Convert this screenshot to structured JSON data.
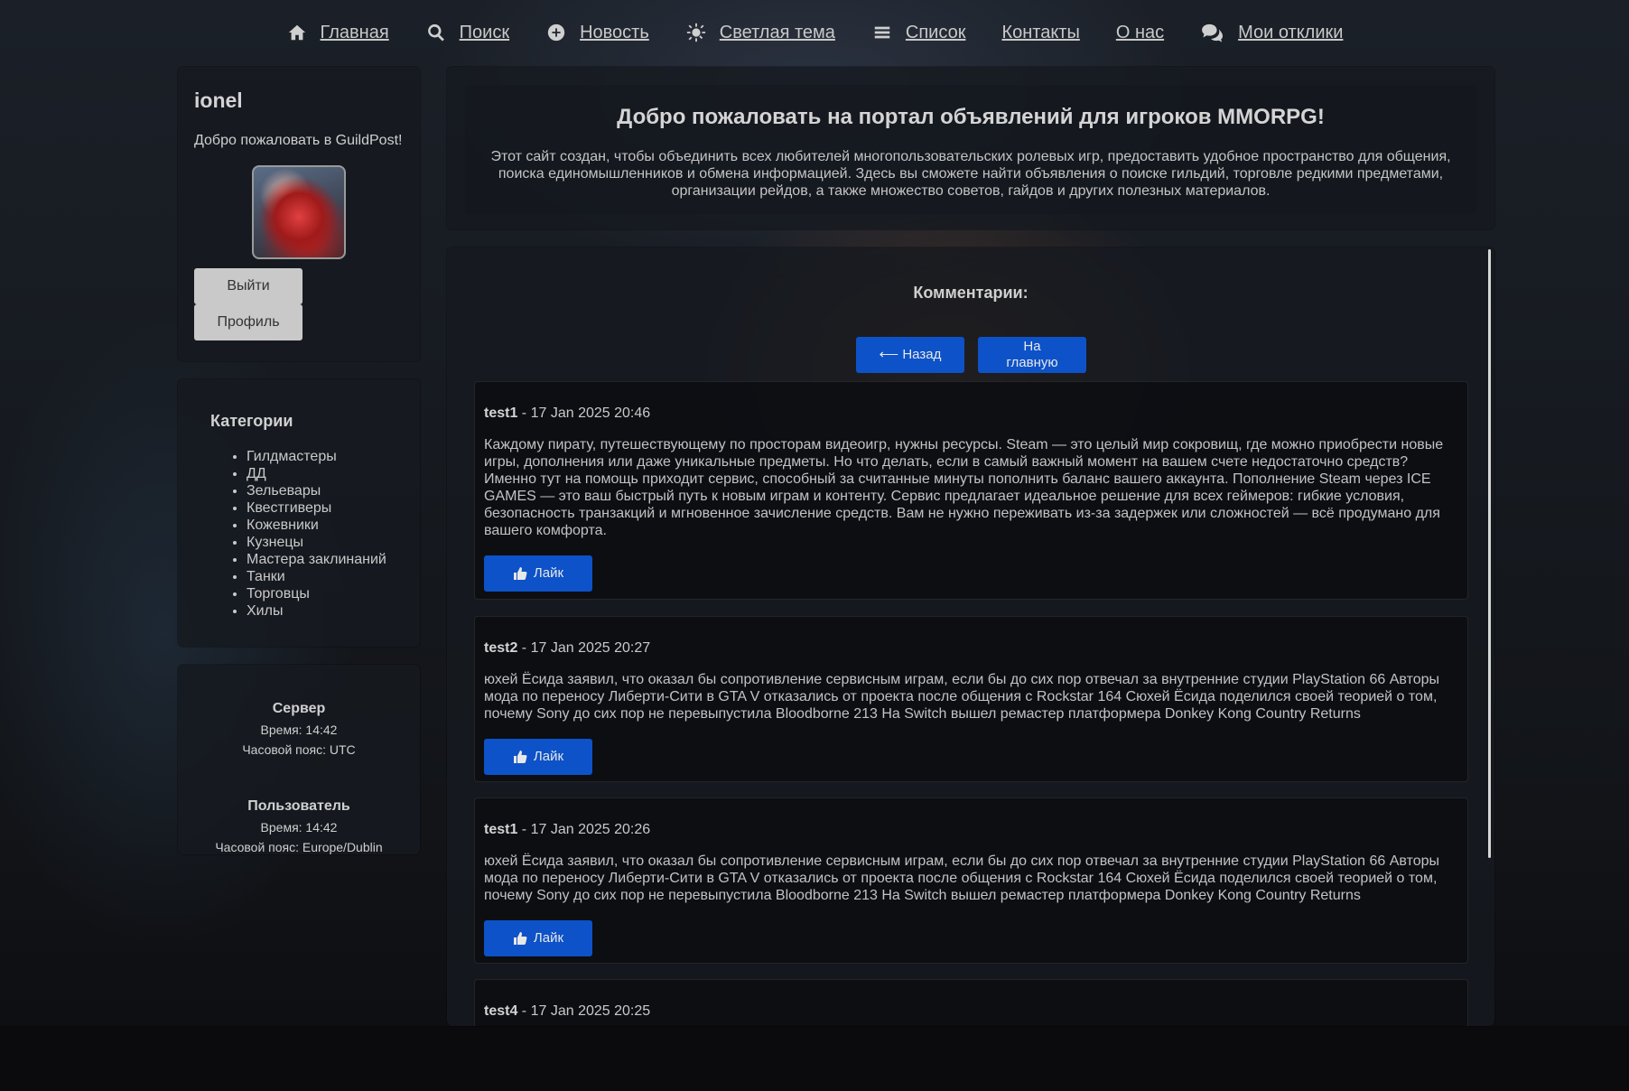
{
  "nav": {
    "items": [
      {
        "label": "Главная",
        "icon": "home-icon"
      },
      {
        "label": "Поиск",
        "icon": "search-icon"
      },
      {
        "label": "Новость",
        "icon": "plus-circle-icon"
      },
      {
        "label": "Светлая тема",
        "icon": "sun-icon"
      },
      {
        "label": "Список",
        "icon": "list-icon"
      },
      {
        "label": "Контакты",
        "icon": ""
      },
      {
        "label": "О нас",
        "icon": ""
      },
      {
        "label": "Мои отклики",
        "icon": "comments-icon"
      }
    ]
  },
  "user": {
    "name": "ionel",
    "welcome": "Добро пожаловать в GuildPost!",
    "logout_label": "Выйти",
    "profile_label": "Профиль"
  },
  "categories": {
    "title": "Категории",
    "items": [
      "Гилдмастеры",
      "ДД",
      "Зельевары",
      "Квестгиверы",
      "Кожевники",
      "Кузнецы",
      "Мастера заклинаний",
      "Танки",
      "Торговцы",
      "Хилы"
    ]
  },
  "time": {
    "server_title": "Сервер",
    "server_time": "Время: 14:42",
    "server_tz": "Часовой пояс: UTC",
    "user_title": "Пользователь",
    "user_time": "Время: 14:42",
    "user_tz": "Часовой пояс: Europe/Dublin"
  },
  "hero": {
    "title": "Добро пожаловать на портал объявлений для игроков MMORPG!",
    "text": "Этот сайт создан, чтобы объединить всех любителей многопользовательских ролевых игр, предоставить удобное пространство для общения, поиска единомышленников и обмена информацией. Здесь вы сможете найти объявления о поиске гильдий, торговле редкими предметами, организации рейдов, а также множество советов, гайдов и других полезных материалов."
  },
  "comments": {
    "title": "Комментарии:",
    "back_label": "⟵ Назад",
    "home_label": "На главную",
    "like_label": "Лайк",
    "items": [
      {
        "author": "test1",
        "date": " - 17 Jan 2025 20:46",
        "text": "Каждому пирату, путешествующему по просторам видеоигр, нужны ресурсы. Steam — это целый мир сокровищ, где можно приобрести новые игры, дополнения или даже уникальные предметы. Но что делать, если в самый важный момент на вашем счете недостаточно средств? Именно тут на помощь приходит сервис, способный за считанные минуты пополнить баланс вашего аккаунта. Пополнение Steam через ICE GAMES — это ваш быстрый путь к новым играм и контенту. Сервис предлагает идеальное решение для всех геймеров: гибкие условия, безопасность транзакций и мгновенное зачисление средств. Вам не нужно переживать из-за задержек или сложностей — всё продумано для вашего комфорта."
      },
      {
        "author": "test2",
        "date": " - 17 Jan 2025 20:27",
        "text": "юхей Ёсида заявил, что оказал бы сопротивление сервисным играм, если бы до сих пор отвечал за внутренние студии PlayStation 66 Авторы мода по переносу Либерти-Сити в GTA V отказались от проекта после общения с Rockstar 164 Сюхей Ёсида поделился своей теорией о том, почему Sony до сих пор не перевыпустила Bloodborne 213 На Switch вышел ремастер платформера Donkey Kong Country Returns"
      },
      {
        "author": "test1",
        "date": " - 17 Jan 2025 20:26",
        "text": "юхей Ёсида заявил, что оказал бы сопротивление сервисным играм, если бы до сих пор отвечал за внутренние студии PlayStation 66 Авторы мода по переносу Либерти-Сити в GTA V отказались от проекта после общения с Rockstar 164 Сюхей Ёсида поделился своей теорией о том, почему Sony до сих пор не перевыпустила Bloodborne 213 На Switch вышел ремастер платформера Donkey Kong Country Returns"
      },
      {
        "author": "test4",
        "date": " - 17 Jan 2025 20:25",
        "text": ""
      }
    ]
  },
  "colors": {
    "accent": "#0d52c8",
    "panel": "#161a20",
    "button_grey": "#c9c9c9"
  }
}
